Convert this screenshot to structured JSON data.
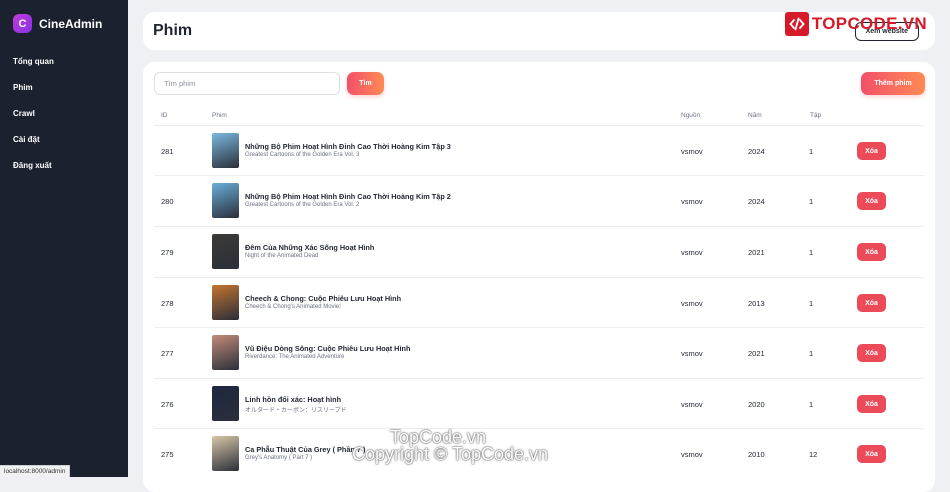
{
  "sidebar": {
    "brand_letter": "C",
    "brand_name": "CineAdmin",
    "items": [
      {
        "label": "Tổng quan"
      },
      {
        "label": "Phim"
      },
      {
        "label": "Crawl"
      },
      {
        "label": "Cài đặt"
      },
      {
        "label": "Đăng xuất"
      }
    ]
  },
  "header": {
    "title": "Phim",
    "button_label": "Xem website"
  },
  "toolbar": {
    "search_placeholder": "Tìm phim",
    "search_value": "",
    "search_button": "Tìm",
    "add_button": "Thêm phim"
  },
  "table": {
    "columns": {
      "id": "ID",
      "film": "Phim",
      "source": "Nguồn",
      "year": "Năm",
      "episodes": "Tập"
    },
    "delete_label": "Xóa",
    "rows": [
      {
        "id": "281",
        "title": "Những Bộ Phim Hoạt Hình Đỉnh Cao Thời Hoàng Kim Tập 3",
        "subtitle": "Greatest Cartoons of the Golden Era Vol. 3",
        "source": "vsmov",
        "year": "2024",
        "episodes": "1",
        "poster_color": "#7bb9e0"
      },
      {
        "id": "280",
        "title": "Những Bộ Phim Hoạt Hình Đỉnh Cao Thời Hoàng Kim Tập 2",
        "subtitle": "Greatest Cartoons of the Golden Era Vol. 2",
        "source": "vsmov",
        "year": "2024",
        "episodes": "1",
        "poster_color": "#6aaed8"
      },
      {
        "id": "279",
        "title": "Đêm Của Những Xác Sống Hoạt Hình",
        "subtitle": "Night of the Animated Dead",
        "source": "vsmov",
        "year": "2021",
        "episodes": "1",
        "poster_color": "#3b3a36"
      },
      {
        "id": "278",
        "title": "Cheech & Chong: Cuộc Phiêu Lưu Hoạt Hình",
        "subtitle": "Cheech & Chong's Animated Movie!",
        "source": "vsmov",
        "year": "2013",
        "episodes": "1",
        "poster_color": "#c4732f"
      },
      {
        "id": "277",
        "title": "Vũ Điệu Dòng Sông: Cuộc Phiêu Lưu Hoạt Hình",
        "subtitle": "Riverdance: The Animated Adventure",
        "source": "vsmov",
        "year": "2021",
        "episodes": "1",
        "poster_color": "#c48b7a"
      },
      {
        "id": "276",
        "title": "Linh hồn đổi xác: Hoạt hình",
        "subtitle": "オルタード・カーボン：リスリーブド",
        "source": "vsmov",
        "year": "2020",
        "episodes": "1",
        "poster_color": "#1f2740"
      },
      {
        "id": "275",
        "title": "Ca Phẫu Thuật Của Grey ( Phần 7 )",
        "subtitle": "Grey's Anatomy ( Part 7 )",
        "source": "vsmov",
        "year": "2010",
        "episodes": "12",
        "poster_color": "#d9c6a6"
      }
    ]
  },
  "status_bar": {
    "url": "localhost:8000/admin"
  },
  "watermark": {
    "logo_text": "TOPCODE.VN",
    "center_text": "TopCode.vn",
    "copyright_text": "Copyright © TopCode.vn"
  },
  "colors": {
    "sidebar_bg": "#1c2130",
    "accent_gradient_start": "#f2506a",
    "accent_gradient_end": "#ff8a54",
    "delete_button": "#ec4a58",
    "brand_gradient": "#c03ad7"
  }
}
